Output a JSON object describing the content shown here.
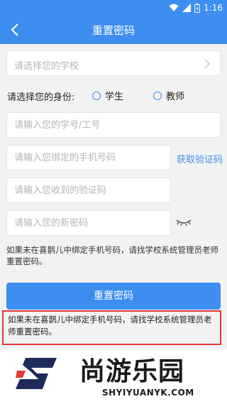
{
  "status_bar": {
    "time": "1:16"
  },
  "nav": {
    "title": "重置密码"
  },
  "form": {
    "school_placeholder": "请选择您的学校",
    "identity_label": "请选择您的身份:",
    "identity_options": [
      "学生",
      "教师"
    ],
    "id_placeholder": "请输入您的学号/工号",
    "phone_placeholder": "请输入您绑定的手机号码",
    "get_code_label": "获取验证码",
    "code_placeholder": "请输入您收到的验证码",
    "new_password_placeholder": "请输入您的新密码"
  },
  "note": "如果未在喜鹊儿中绑定手机号码，请找学校系统管理员老师重置密码。",
  "reset_button": "重置密码",
  "highlighted_note": "如果未在喜鹊儿中绑定手机号码，请找学校系统管理员老师重置密码。",
  "watermark": {
    "brand": "尚游乐园",
    "url": "SHYIYUANYK.COM"
  },
  "colors": {
    "primary": "#3d8ef0",
    "highlight_border": "#e53935"
  }
}
